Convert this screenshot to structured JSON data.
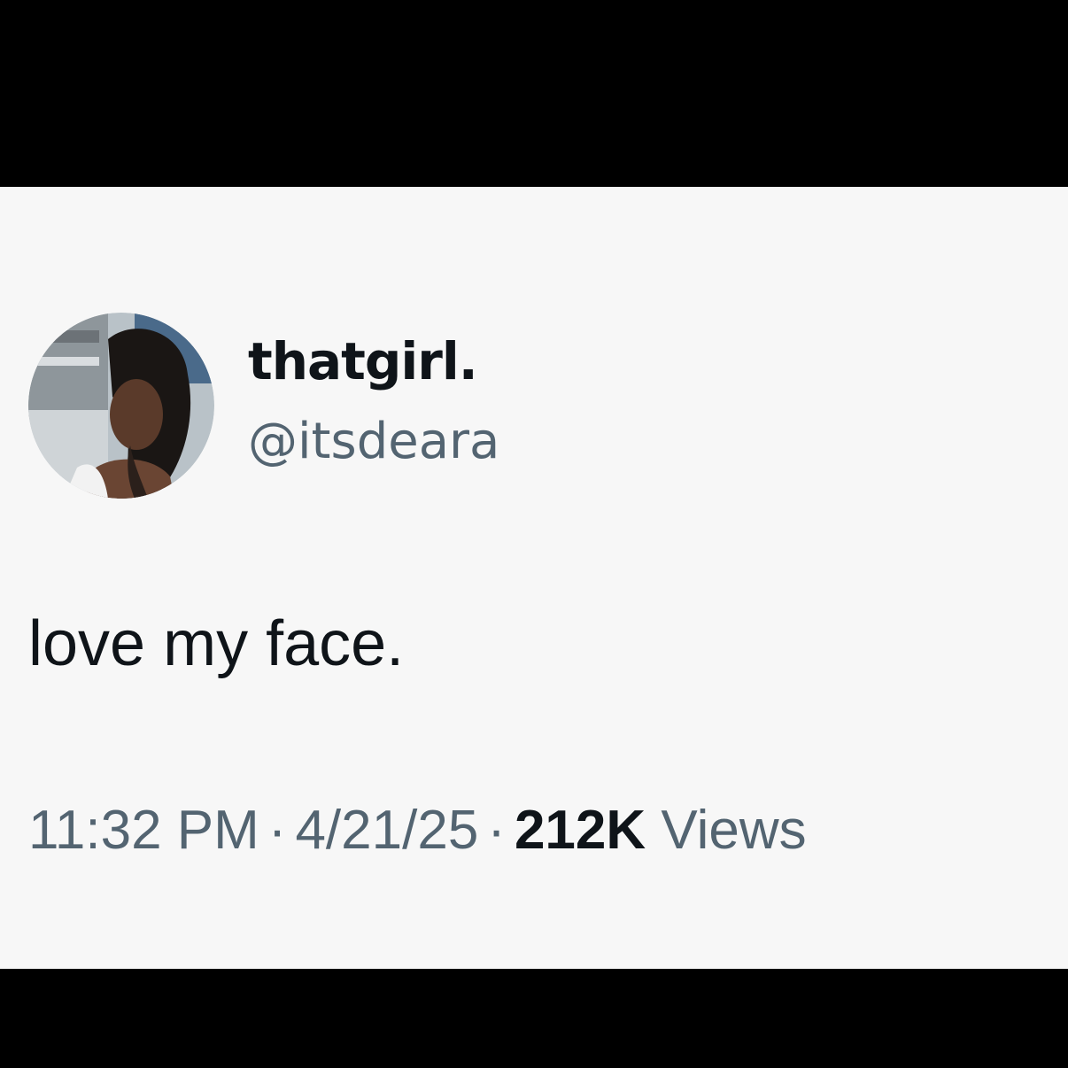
{
  "tweet": {
    "author": {
      "display_name": "thatgirl.",
      "handle": "@itsdeara",
      "avatar_icon": "profile-photo-avatar"
    },
    "text": "love my face.",
    "meta": {
      "time": "11:32 PM",
      "separator": "·",
      "date": "4/21/25",
      "views_count": "212K",
      "views_label": "Views"
    }
  },
  "colors": {
    "background": "#f7f7f7",
    "letterbox": "#000000",
    "primary_text": "#0f1419",
    "secondary_text": "#536471"
  }
}
